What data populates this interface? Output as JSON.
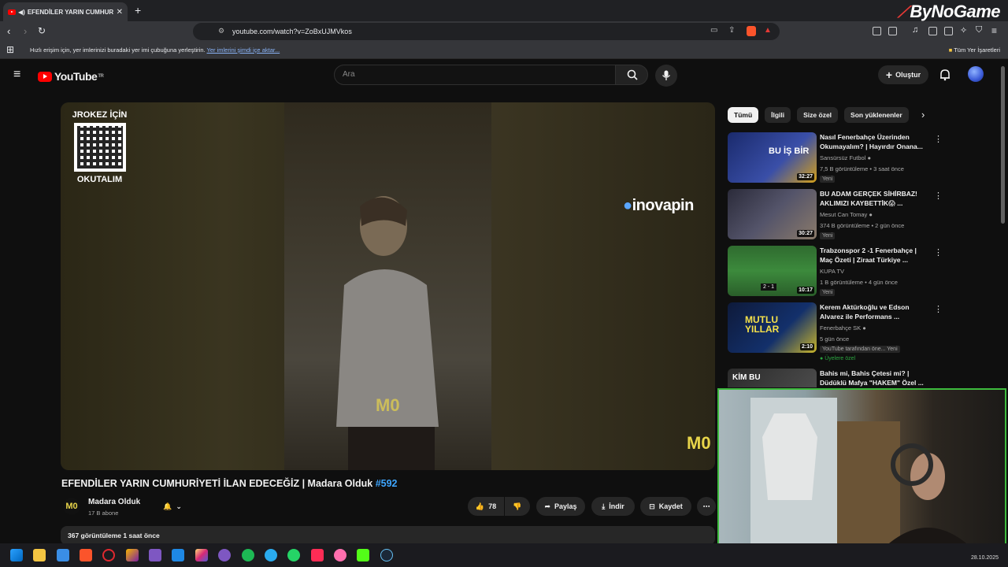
{
  "browser": {
    "tab_title": "EFENDİLER YARIN CUMHURİY",
    "new_tab": "+",
    "url": "youtube.com/watch?v=ZoBxUJMVkos",
    "bookmark_message": "Hızlı erişim için, yer imlerinizi buradaki yer imi çubuğuna yerleştirin.",
    "bookmark_link": "Yer imlerini şimdi içe aktar...",
    "bookmark_all": "Tüm Yer İşaretleri",
    "overlay_brand": "ByNoGame"
  },
  "yt": {
    "logo_text": "YouTube",
    "logo_region": "TR",
    "search_placeholder": "Ara",
    "create_label": "Oluştur"
  },
  "player": {
    "qr_top": "JROKEZ İÇİN",
    "qr_bottom": "OKUTALIM",
    "sponsor": "inovapin",
    "watermark": "M0"
  },
  "video": {
    "title": "EFENDİLER YARIN CUMHURİYETİ İLAN EDECEĞİZ | Madara Olduk",
    "hashtag": "#592",
    "channel": "Madara Olduk",
    "channel_logo": "M0",
    "subscribers": "17 B abone",
    "likes": "78",
    "share": "Paylaş",
    "download": "İndir",
    "save": "Kaydet",
    "views_time": "367 görüntüleme  1 saat önce"
  },
  "chips": [
    "Tümü",
    "İlgili",
    "Size özel",
    "Son yüklenenler"
  ],
  "recommendations": [
    {
      "title": "Nasıl Fenerbahçe Üzerinden Okumayalım? | Hayırdır Onana...",
      "channel": "Sansürsüz Futbol",
      "meta": "7,5 B görüntüleme • 3 saat önce",
      "badge": "Yeni",
      "duration": "32:27",
      "thumb_text": "BU İŞ BİR"
    },
    {
      "title": "BU ADAM GERÇEK SİHİRBAZ! AKLIMIZI KAYBETTİK😱 ...",
      "channel": "Mesut Can Tomay",
      "meta": "374 B görüntüleme • 2 gün önce",
      "badge": "Yeni",
      "duration": "30:27",
      "thumb_text": ""
    },
    {
      "title": "Trabzonspor 2 -1 Fenerbahçe | Maç Özeti | Ziraat Türkiye ...",
      "channel": "KUPA TV",
      "meta": "1 B görüntüleme • 4 gün önce",
      "badge": "Yeni",
      "duration": "10:17",
      "thumb_text": "2 - 1"
    },
    {
      "title": "Kerem Aktürkoğlu ve Edson Alvarez ile Performans ...",
      "channel": "Fenerbahçe SK",
      "meta": "5 gün önce",
      "badge": "YouTube tarafından öne...  Yeni",
      "badge2": "Üyelere özel",
      "duration": "2:10",
      "thumb_text": "MUTLU YILLAR"
    },
    {
      "title": "Bahis mi, Bahis Çetesi mi? | Düdüklü Mafya \"HAKEM\" Özel ...",
      "channel": "",
      "meta": "",
      "badge": "",
      "duration": "",
      "thumb_text": "KİM BU"
    }
  ],
  "taskbar": {
    "date": "28.10.2025"
  }
}
